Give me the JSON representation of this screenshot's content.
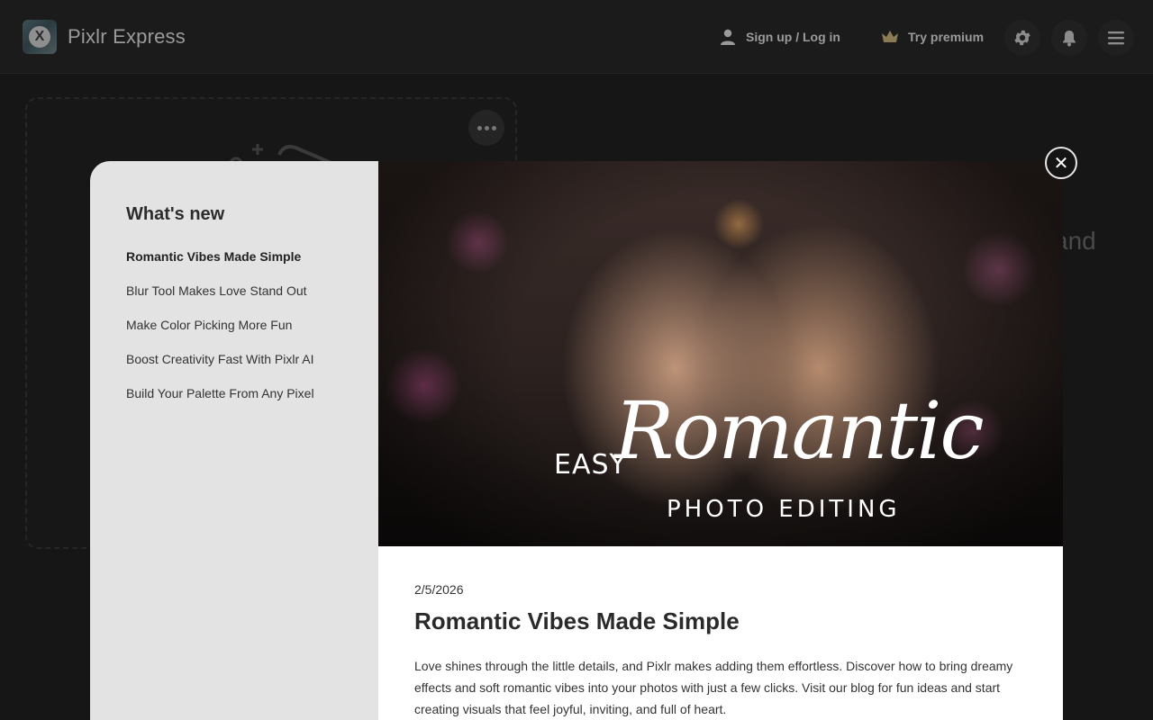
{
  "header": {
    "app_title": "Pixlr Express",
    "logo_letter": "X",
    "signup_label": "Sign up / Log in",
    "premium_label": "Try premium",
    "icons": [
      "user-icon",
      "crown-icon",
      "gear-icon",
      "bell-icon",
      "hamburger-icon"
    ]
  },
  "background": {
    "heading_fragment": "and"
  },
  "modal": {
    "sidebar_title": "What's new",
    "items": [
      {
        "label": "Romantic Vibes Made Simple",
        "active": true
      },
      {
        "label": "Blur Tool Makes Love Stand Out",
        "active": false
      },
      {
        "label": "Make Color Picking More Fun",
        "active": false
      },
      {
        "label": "Boost Creativity Fast With Pixlr AI",
        "active": false
      },
      {
        "label": "Build Your Palette From Any Pixel",
        "active": false
      }
    ],
    "hero": {
      "easy": "EASY",
      "romantic": "Romantic",
      "photo_editing": "PHOTO EDITING"
    },
    "article": {
      "date": "2/5/2026",
      "title": "Romantic Vibes Made Simple",
      "body": "Love shines through the little details, and Pixlr makes adding them effortless. Discover how to bring dreamy effects and soft romantic vibes into your photos with just a few clicks. Visit our blog for fun ideas and start creating visuals that feel joyful, inviting, and full of heart."
    },
    "close_glyph": "✕"
  },
  "colors": {
    "page_bg": "#161616",
    "sidebar_bg": "#e3e3e3",
    "main_bg": "#ffffff",
    "text_dark": "#2a2a2a"
  }
}
